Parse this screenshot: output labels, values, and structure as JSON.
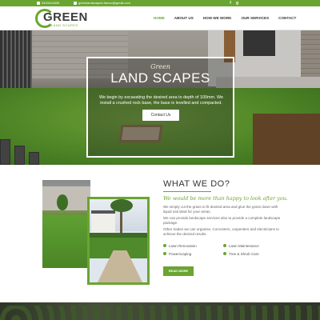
{
  "topbar": {
    "phone": "0403414526",
    "email": "greenlandscapes.franco@gmail.com",
    "social": [
      "f",
      "g"
    ]
  },
  "brand": {
    "logo_word": "GREEN",
    "logo_sub": "LAND SCAPES"
  },
  "nav": {
    "items": [
      {
        "label": "HOME",
        "active": true
      },
      {
        "label": "ABOUT US",
        "active": false
      },
      {
        "label": "HOW WE WORK",
        "active": false
      },
      {
        "label": "OUR SERVICES",
        "active": false
      },
      {
        "label": "CONTACT",
        "active": false
      }
    ]
  },
  "hero": {
    "script": "Green",
    "title": "LAND SCAPES",
    "description": "We begin by excavating the desired area to depth of 100mm. We install a crushed rock base, the base is levelled and compacted.",
    "button_label": "Contact Us",
    "slides": 3,
    "active_slide": 1
  },
  "what_we_do": {
    "heading": "WHAT WE DO?",
    "tagline": "We would be more than happy to look after you.",
    "paragraph1": "We simply cut the grass to fit desired area and glue the grass down with liquid nail ideal for your areas.",
    "paragraph2": "We can provide landscape services also to provide a complete landscape package.",
    "paragraph3": "Other trades we can organise, Concreters, carpenters and electricians to achieve the desired results.",
    "services": [
      "Lawn Renovation",
      "Lawn Maintenance",
      "Powerscaping",
      "Tree & Shrub Care"
    ],
    "button_label": "READ MORE"
  },
  "colors": {
    "accent": "#6aa531",
    "text": "#333333"
  }
}
